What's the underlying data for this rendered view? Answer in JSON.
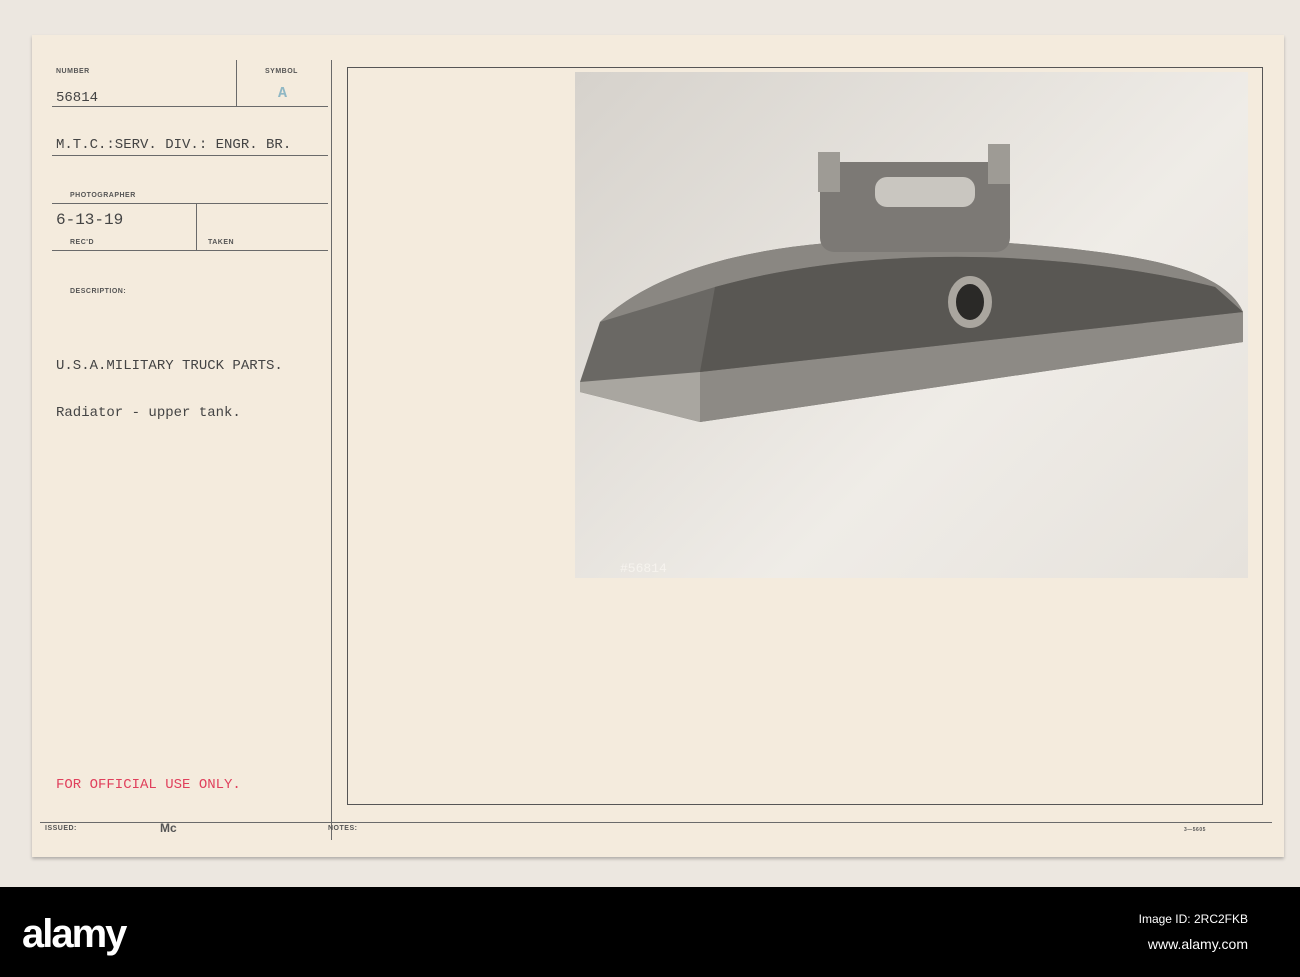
{
  "card": {
    "number_label": "NUMBER",
    "symbol_label": "SYMBOL",
    "number": "56814",
    "symbol": "A",
    "unit": "M.T.C.:SERV. DIV.: ENGR. BR.",
    "photographer_label": "PHOTOGRAPHER",
    "received_date": "6-13-19",
    "recd_label": "REC'D",
    "taken_label": "TAKEN",
    "description_label": "DESCRIPTION:",
    "description_line1": "U.S.A.MILITARY TRUCK PARTS.",
    "description_line2": "Radiator - upper tank.",
    "restriction": "FOR OFFICIAL USE ONLY.",
    "issued_label": "ISSUED:",
    "issued_by": "Mc",
    "notes_label": "NOTES:",
    "form_number": "3—5605",
    "photo_number": "#56814"
  },
  "watermark": {
    "logo": "alamy",
    "image_id": "Image ID: 2RC2FKB",
    "url": "www.alamy.com"
  }
}
